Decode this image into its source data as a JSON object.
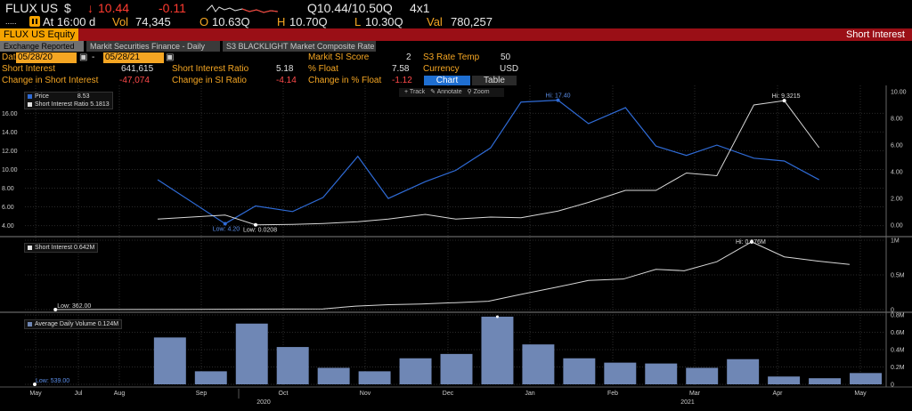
{
  "quote": {
    "ticker": "FLUX US",
    "currency_sym": "$",
    "arrow": "↓",
    "last": "10.44",
    "change": "-0.11",
    "bid_ask": "Q10.44/10.50Q",
    "size": "4x1",
    "at_time": "At 16:00 d",
    "vol_label": "Vol",
    "vol": "74,345",
    "open_label": "O",
    "open": "10.63Q",
    "high_label": "H",
    "high": "10.70Q",
    "low_label": "L",
    "low": "10.30Q",
    "val_label": "Val",
    "val": "780,257"
  },
  "title_bar": {
    "security": "FLUX US Equity",
    "function": "Short Interest"
  },
  "tabs": [
    {
      "label": "Exchange Reported"
    },
    {
      "label": "Markit Securities Finance - Daily"
    },
    {
      "label": "S3 BLACKLIGHT Market Composite Rate"
    }
  ],
  "controls": {
    "date_label": "Date",
    "start_date": "05/28/20",
    "date_sep": "-",
    "end_date": "05/28/21",
    "markit_label": "Markit SI Score",
    "markit_value": "2",
    "s3_label": "S3 Rate Temp",
    "s3_value": "50",
    "si_label": "Short Interest",
    "si_value": "641,615",
    "sir_label": "Short Interest Ratio",
    "sir_value": "5.18",
    "float_label": "% Float",
    "float_value": "7.58",
    "currency_label": "Currency",
    "currency_value": "USD",
    "chg_si_label": "Change in Short Interest",
    "chg_si_value": "-47,074",
    "chg_sir_label": "Change in SI Ratio",
    "chg_sir_value": "-4.14",
    "chg_float_label": "Change in % Float",
    "chg_float_value": "-1.12",
    "chart_btn": "Chart",
    "table_btn": "Table"
  },
  "toolbar": {
    "track": "Track",
    "annotate": "Annotate",
    "zoom": "Zoom"
  },
  "colors": {
    "price": "#2f6bd6",
    "white_line": "#d8d8d8",
    "bar": "#6f87b5",
    "grid": "#2a2a2a"
  },
  "chart_data": [
    {
      "type": "line",
      "panel": "top",
      "x": [
        "2020-07-01",
        "2020-08-01",
        "2020-08-15",
        "2020-09-01",
        "2020-09-15",
        "2020-10-01",
        "2020-10-15",
        "2020-11-01",
        "2020-11-15",
        "2020-12-01",
        "2020-12-15",
        "2021-01-01",
        "2021-01-15",
        "2021-02-01",
        "2021-02-15",
        "2021-03-01",
        "2021-03-15",
        "2021-04-01",
        "2021-04-15",
        "2021-05-01"
      ],
      "series": [
        {
          "name": "Price",
          "legend_value": "8.53",
          "axis": "left",
          "values": [
            8.9,
            4.2,
            6.1,
            5.5,
            7.0,
            11.4,
            6.9,
            8.7,
            9.9,
            12.3,
            17.2,
            17.4,
            14.9,
            16.6,
            12.5,
            11.5,
            12.6,
            11.2,
            10.9,
            8.9
          ]
        },
        {
          "name": "Short Interest Ratio",
          "legend_value": "5.1813",
          "axis": "right",
          "values": [
            0.45,
            0.75,
            0.0208,
            0.05,
            0.12,
            0.25,
            0.45,
            0.8,
            0.45,
            0.6,
            0.55,
            1.05,
            1.7,
            2.6,
            2.6,
            3.9,
            3.7,
            9.0,
            9.3215,
            5.8
          ]
        }
      ],
      "left_ticks": [
        "16.00",
        "14.00",
        "12.00",
        "10.00",
        "8.00",
        "6.00",
        "4.00"
      ],
      "right_ticks": [
        "10.00",
        "8.00",
        "6.00",
        "4.00",
        "2.00",
        "0.00"
      ],
      "ylim_left": [
        3.2,
        18.6
      ],
      "ylim_right": [
        -0.6,
        10.2
      ],
      "annotations": [
        {
          "text": "Low: 4.20",
          "series": 0,
          "index": 1
        },
        {
          "text": "Hi: 17.40",
          "series": 0,
          "index": 11
        },
        {
          "text": "Low: 0.0208",
          "series": 1,
          "index": 2
        },
        {
          "text": "Hi: 9.3215",
          "series": 1,
          "index": 18
        }
      ]
    },
    {
      "type": "line",
      "panel": "middle",
      "series": [
        {
          "name": "Short Interest",
          "legend_value": "0.642M",
          "values": [
            0.0,
            0.002,
            0.004,
            0.006,
            0.01,
            0.05,
            0.07,
            0.08,
            0.1,
            0.12,
            0.22,
            0.32,
            0.42,
            0.44,
            0.58,
            0.56,
            0.69,
            0.976,
            0.76,
            0.7,
            0.65
          ]
        }
      ],
      "x": [
        "2020-05-15",
        "2020-06-15",
        "2020-07-15",
        "2020-08-15",
        "2020-09-15",
        "2020-09-30",
        "2020-10-15",
        "2020-10-30",
        "2020-11-15",
        "2020-11-30",
        "2020-12-15",
        "2020-12-31",
        "2021-01-15",
        "2021-01-31",
        "2021-02-15",
        "2021-02-28",
        "2021-03-15",
        "2021-03-31",
        "2021-04-15",
        "2021-04-30",
        "2021-05-15"
      ],
      "right_ticks": [
        "1M",
        "0.5M",
        "0"
      ],
      "ylim": [
        0,
        1.0
      ],
      "annotations": [
        {
          "text": "Low: 362.00",
          "index": 0
        },
        {
          "text": "Hi: 0.976M",
          "index": 17
        }
      ]
    },
    {
      "type": "bar",
      "panel": "bottom",
      "series": [
        {
          "name": "Average Daily Volume",
          "legend_value": "0.124M",
          "values": [
            0.0,
            0.0,
            0.0,
            0.54,
            0.15,
            0.7,
            0.43,
            0.19,
            0.15,
            0.3,
            0.35,
            0.78,
            0.46,
            0.3,
            0.25,
            0.24,
            0.19,
            0.29,
            0.09,
            0.07,
            0.13
          ]
        }
      ],
      "right_ticks": [
        "0.8M",
        "0.6M",
        "0.4M",
        "0.2M",
        "0"
      ],
      "ylim": [
        0,
        0.8
      ],
      "annotations": [
        {
          "text": "Low: 539.00",
          "index": 0
        }
      ]
    }
  ],
  "x_axis": {
    "months": [
      "May",
      "Jul",
      "Aug",
      "Sep",
      "Oct",
      "Nov",
      "Dec",
      "Jan",
      "Feb",
      "Mar",
      "Apr",
      "May"
    ],
    "years": [
      "2020",
      "2021"
    ]
  }
}
